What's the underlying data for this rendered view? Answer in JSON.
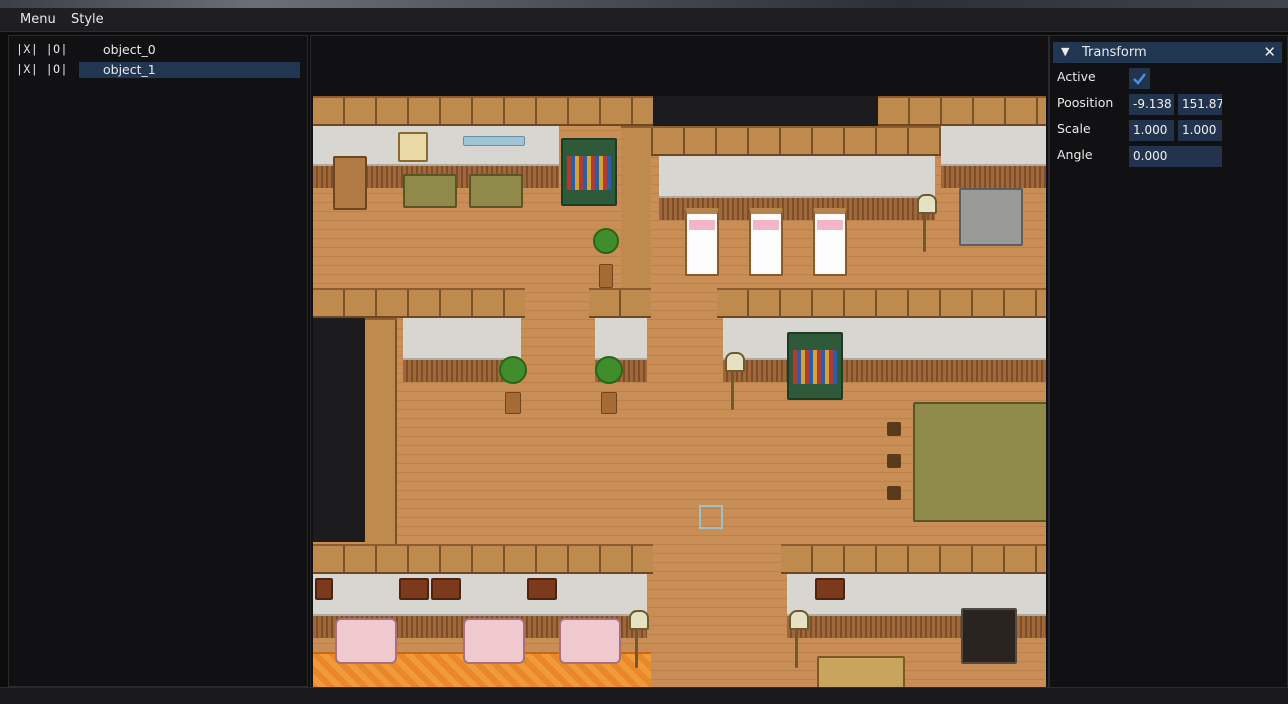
{
  "menu": {
    "items": [
      "Menu",
      "Style"
    ]
  },
  "hierarchy": {
    "objects": [
      {
        "toggles": "|X| |O|",
        "name": "object_0",
        "selected": false
      },
      {
        "toggles": "|X| |O|",
        "name": "object_1",
        "selected": true
      }
    ]
  },
  "inspector": {
    "title": "Transform",
    "close_icon": "close-icon",
    "collapse_icon": "triangle-down-icon",
    "active_label": "Active",
    "active_checked": true,
    "position_label": "Poosition",
    "position_x": "-9.138",
    "position_y": "151.87",
    "scale_label": "Scale",
    "scale_x": "1.000",
    "scale_y": "1.000",
    "angle_label": "Angle",
    "angle_value": "0.000"
  },
  "colors": {
    "accent": "#213651",
    "field_bg": "#22344d",
    "check": "#4a90e2"
  }
}
